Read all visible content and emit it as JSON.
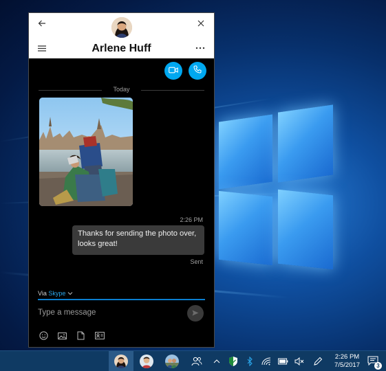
{
  "chat": {
    "contact_name": "Arlene Huff",
    "day_separator": "Today",
    "messages": [
      {
        "time": "2:26 PM",
        "text": "Thanks for sending the photo over, looks great!",
        "status": "Sent"
      }
    ],
    "via_prefix": "Via",
    "via_service": "Skype",
    "compose_placeholder": "Type a message",
    "accent_color": "#00a8f0"
  },
  "icons": {
    "header": [
      "back-arrow-icon",
      "close-icon",
      "hamburger-menu-icon",
      "more-options-icon"
    ],
    "calls": [
      "video-camera-icon",
      "phone-icon"
    ],
    "compose_tools": [
      "emoji-icon",
      "image-icon",
      "file-icon",
      "contact-card-icon"
    ],
    "taskbar_tray": [
      "people-icon",
      "show-hidden-icons-chevron-icon",
      "windows-defender-icon",
      "bluetooth-icon",
      "wifi-icon",
      "battery-icon",
      "mute-icon",
      "pen-icon",
      "action-center-icon"
    ]
  },
  "taskbar": {
    "clock_time": "2:26 PM",
    "clock_date": "7/5/2017",
    "notification_count": "3"
  }
}
